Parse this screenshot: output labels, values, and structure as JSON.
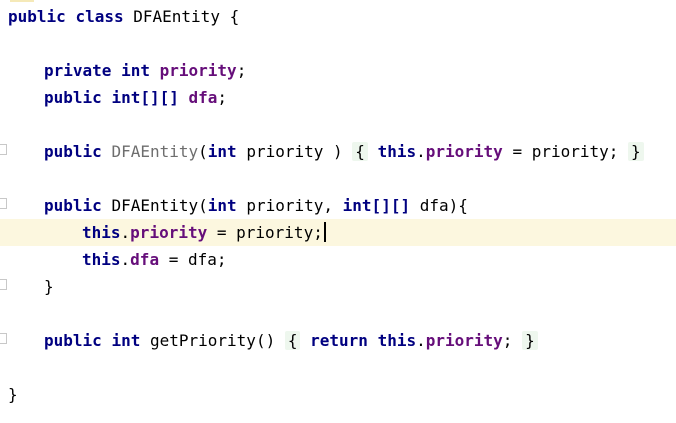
{
  "editor": {
    "lines": {
      "class_decl": {
        "kw_public": "public",
        "kw_class": "class",
        "name": "DFAEntity",
        "brace": "{"
      },
      "field_priority": {
        "kw_private": "private",
        "kw_int": "int",
        "field": "priority",
        "semi": ";"
      },
      "field_dfa": {
        "kw_public": "public",
        "kw_type": "int[][]",
        "field": "dfa",
        "semi": ";"
      },
      "ctor1": {
        "kw_public": "public",
        "name": "DFAEntity",
        "open_paren": "(",
        "kw_int": "int",
        "param": " priority ",
        "close_paren": ")",
        "fold_open": "{",
        "kw_this": "this",
        "dot": ".",
        "field": "priority",
        "assign": " = priority; ",
        "fold_close": "}"
      },
      "ctor2": {
        "kw_public": "public",
        "name": "DFAEntity",
        "open_paren": "(",
        "kw_int": "int",
        "param1": " priority, ",
        "kw_type": "int[][]",
        "param2": " dfa){"
      },
      "assign_priority": {
        "kw_this": "this",
        "dot": ".",
        "field": "priority",
        "rest": " = priority;"
      },
      "assign_dfa": {
        "kw_this": "this",
        "dot": ".",
        "field": "dfa",
        "rest": " = dfa;"
      },
      "ctor2_close": {
        "brace": "}"
      },
      "getter": {
        "kw_public": "public",
        "kw_int": "int",
        "name": " getPriority() ",
        "fold_open": "{",
        "kw_return": "return",
        "kw_this": "this",
        "dot": ".",
        "field": "priority",
        "semi": "; ",
        "fold_close": "}"
      },
      "class_close": {
        "brace": "}"
      }
    }
  },
  "colors": {
    "keyword": "#000080",
    "field": "#660e7a",
    "folded_ctor_name": "#6e6e6e",
    "current_line": "#fcf7df",
    "fold_region": "#eef7ee"
  }
}
